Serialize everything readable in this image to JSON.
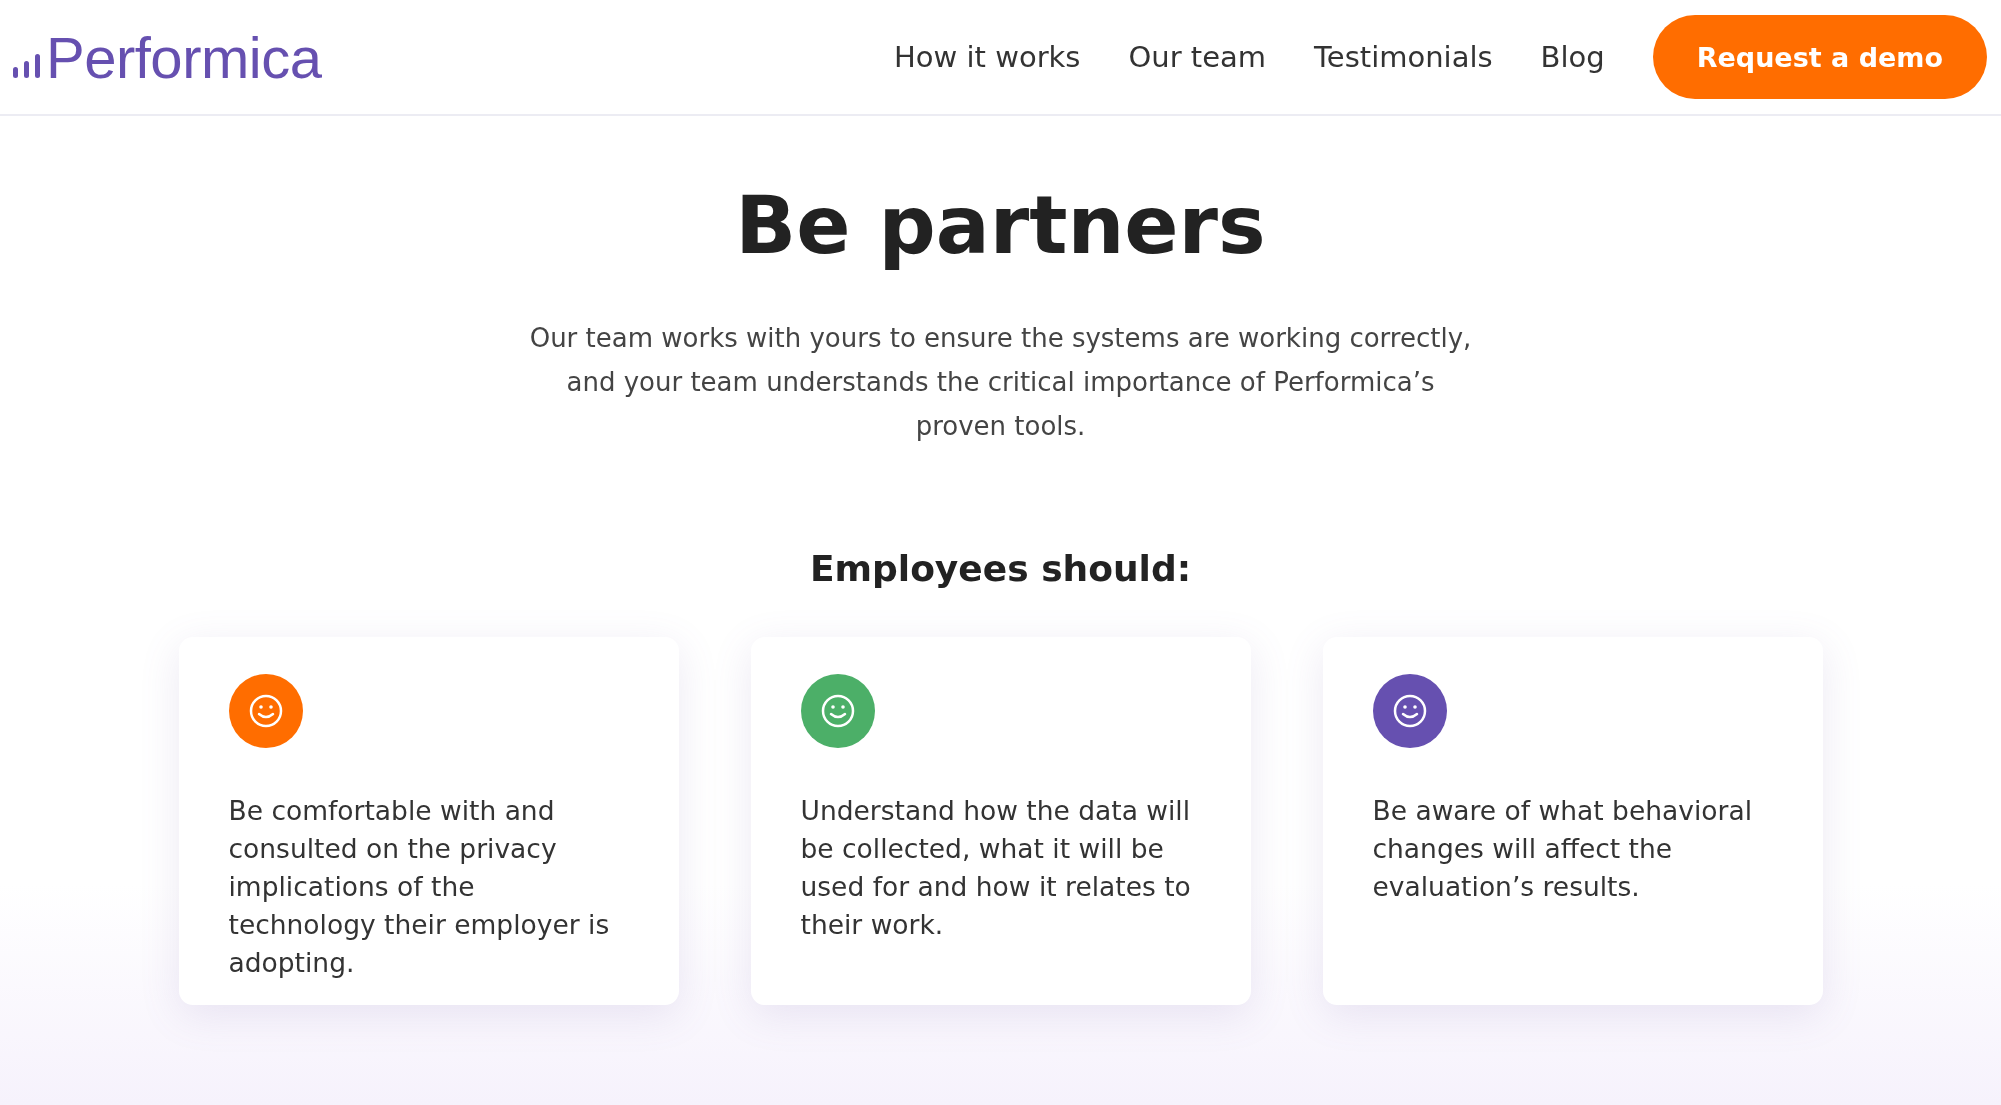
{
  "header": {
    "logo": "Performica",
    "nav": [
      {
        "label": "How it works"
      },
      {
        "label": "Our team"
      },
      {
        "label": "Testimonials"
      },
      {
        "label": "Blog"
      }
    ],
    "cta": "Request a demo"
  },
  "hero": {
    "title": "Be partners",
    "text": "Our team works with yours to ensure the systems are working correctly, and your team understands the critical importance of Performica’s proven tools."
  },
  "section": {
    "heading": "Employees should:",
    "cards": [
      {
        "color": "#ff6d00",
        "text": "Be comfortable with and consulted on the privacy implications of the technology their employer is adopting."
      },
      {
        "color": "#4caf68",
        "text": "Understand how the data will be collected, what it will be used for and how it relates to their work."
      },
      {
        "color": "#6650b0",
        "text": "Be aware of what behavioral changes will affect the evaluation’s results."
      }
    ]
  }
}
